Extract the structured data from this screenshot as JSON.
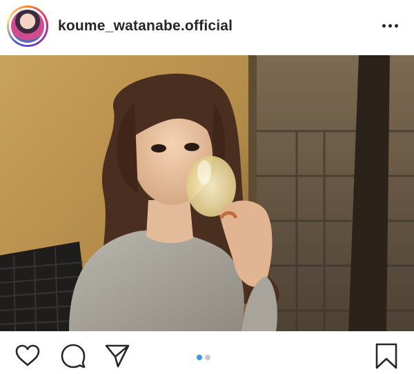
{
  "post": {
    "username": "koume_watanabe.official",
    "avatar_icon": "profile-avatar",
    "more_icon": "more-horizontal-icon"
  },
  "actions": {
    "like_icon": "heart-icon",
    "comment_icon": "comment-icon",
    "share_icon": "send-icon",
    "save_icon": "bookmark-icon"
  },
  "carousel": {
    "total": 2,
    "active_index": 1,
    "active_color": "#3897f0",
    "inactive_color": "#c7c7c7"
  }
}
